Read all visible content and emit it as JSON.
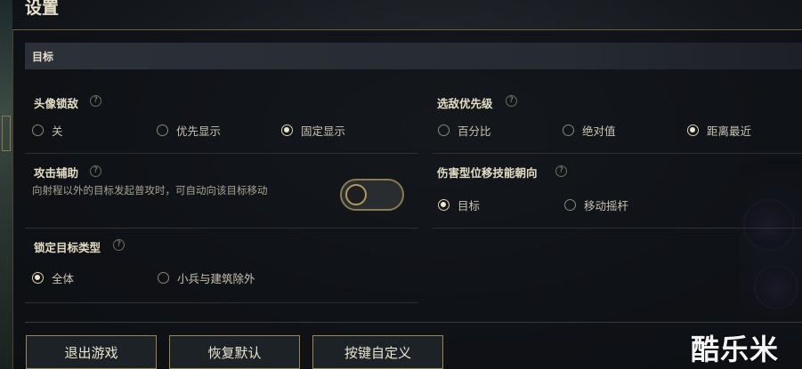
{
  "window": {
    "title": "设置"
  },
  "section": {
    "title": "目标"
  },
  "left": {
    "avatar_lock": {
      "label": "头像锁敌",
      "help": "?",
      "options": [
        "关",
        "优先显示",
        "固定显示"
      ],
      "selected": 2
    },
    "attack_assist": {
      "label": "攻击辅助",
      "help": "?",
      "description": "向射程以外的目标发起普攻时，可自动向该目标移动",
      "enabled": false
    },
    "lock_target_type": {
      "label": "锁定目标类型",
      "help": "?",
      "options": [
        "全体",
        "小兵与建筑除外"
      ],
      "selected": 0
    }
  },
  "right": {
    "enemy_priority": {
      "label": "选敌优先级",
      "help": "?",
      "options": [
        "百分比",
        "绝对值",
        "距离最近"
      ],
      "selected": 2
    },
    "displacement_direction": {
      "label": "伤害型位移技能朝向",
      "help": "?",
      "options": [
        "目标",
        "移动摇杆"
      ],
      "selected": 0
    }
  },
  "footer": {
    "buttons": [
      "退出游戏",
      "恢复默认",
      "按键自定义"
    ]
  },
  "watermark": "酷乐米"
}
